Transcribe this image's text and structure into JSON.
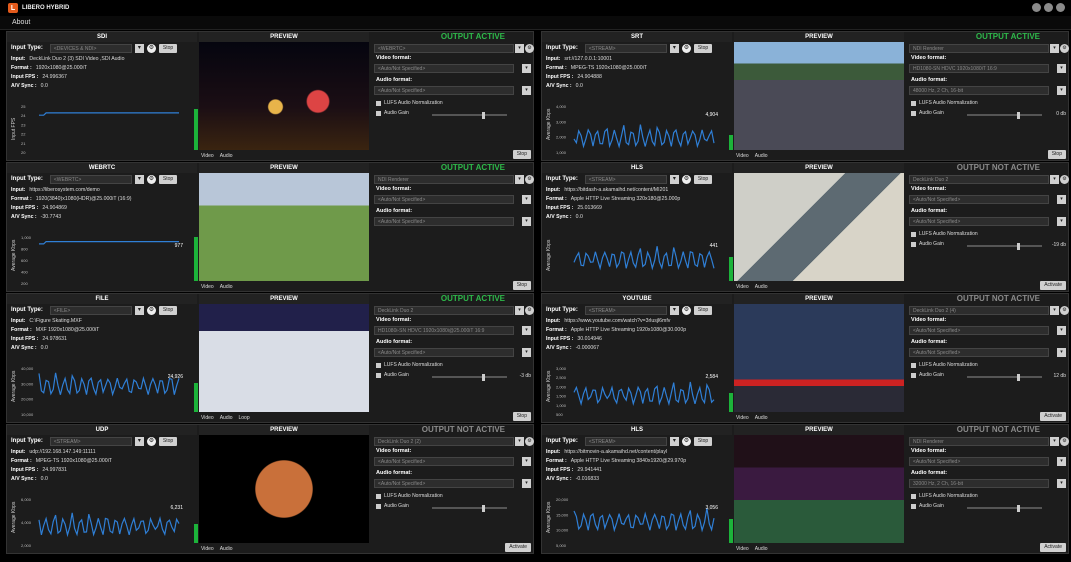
{
  "app": {
    "title": "LIBERO HYBRID",
    "menu": [
      "About"
    ]
  },
  "panels": [
    {
      "id": "sdi",
      "source_title": "SDI",
      "input_type_placeholder": "<DEVICES & NDI>",
      "action": "Stop",
      "input_label": "Input:",
      "input": "DeckLink Duo 2 (3) SDI Video ,SDI Audio",
      "format_label": "Format :",
      "format": "1920x1080@25.000iT",
      "fps_label": "Input FPS :",
      "fps": "24.996367",
      "sync_label": "A/V Sync :",
      "sync": "0.0",
      "chart": {
        "ylabel": "Input FPS",
        "yticks": [
          "25",
          "24",
          "23",
          "22",
          "21",
          "20"
        ],
        "level": 0.85,
        "value_label": ""
      },
      "preview_footer": [
        "Video",
        "Audio"
      ],
      "output": {
        "status": "OUTPUT ACTIVE",
        "active": true,
        "renderer_placeholder": "<WEBRTC>",
        "video_format_label": "Video format:",
        "video_format": "<Auto/Not Specified>",
        "audio_format_label": "Audio format:",
        "audio_format": "<Auto/Not Specified>",
        "lufs": "LUFS Audio Normalization",
        "gain_label": "Audio Gain",
        "gain_value": "",
        "button": "Stop"
      }
    },
    {
      "id": "webrtc",
      "source_title": "WEBRTC",
      "input_type_placeholder": "<WEBRTC>",
      "action": "Stop",
      "input_label": "Input:",
      "input": "https://liberosystem.com/demo",
      "format_label": "Format :",
      "format": "1920(3840)x1080(HDR)@25.000iT (16:9)",
      "fps_label": "Input FPS :",
      "fps": "24.904869",
      "sync_label": "A/V Sync :",
      "sync": "-30.7743",
      "chart": {
        "ylabel": "Average Kbps",
        "yticks": [
          "1,000",
          "800",
          "600",
          "400",
          "200"
        ],
        "level": 0.9,
        "value_label": "977"
      },
      "preview_footer": [
        "Video",
        "Audio"
      ],
      "output": {
        "status": "OUTPUT ACTIVE",
        "active": true,
        "renderer_placeholder": "NDI Renderer",
        "video_format_label": "Video format:",
        "video_format": "<Auto/Not Specified>",
        "audio_format_label": "Audio format:",
        "audio_format": "<Auto/Not Specified>",
        "lufs": "",
        "gain_label": "",
        "gain_value": "",
        "button": "Stop"
      }
    },
    {
      "id": "file",
      "source_title": "FILE",
      "input_type_placeholder": "<FILE>",
      "action": "Stop",
      "input_label": "Input:",
      "input": "C:\\Figure Skating.MXF",
      "format_label": "Format :",
      "format": "MXF  1920x1080@25.000iT",
      "fps_label": "Input FPS :",
      "fps": "24.978631",
      "sync_label": "A/V Sync :",
      "sync": "0.0",
      "chart": {
        "ylabel": "Average Kbps",
        "yticks": [
          "40,000",
          "30,000",
          "20,000",
          "10,000"
        ],
        "level": 0.6,
        "value_label": "24,926"
      },
      "preview_footer": [
        "Video",
        "Audio",
        "Loop"
      ],
      "output": {
        "status": "OUTPUT ACTIVE",
        "active": true,
        "renderer_placeholder": "DeckLink Duo 2",
        "video_format_label": "Video format:",
        "video_format": "HD1080i-SN HDVC  1920x1080i@25.000iT 16:9",
        "audio_format_label": "Audio format:",
        "audio_format": "<Auto/Not Specified>",
        "lufs": "LUFS Audio Normalization",
        "gain_label": "Audio Gain",
        "gain_value": "-3 db",
        "button": "Stop"
      }
    },
    {
      "id": "udp",
      "source_title": "UDP",
      "input_type_placeholder": "<STREAM>",
      "action": "Stop",
      "input_label": "Input:",
      "input": "udp://192.168.147.149:11111",
      "format_label": "Format :",
      "format": "MPEG-TS  1920x1080@25.000iT",
      "fps_label": "Input FPS :",
      "fps": "24.997831",
      "sync_label": "A/V Sync :",
      "sync": "0.0",
      "chart": {
        "ylabel": "Average Kbps",
        "yticks": [
          "6,000",
          "4,000",
          "2,000"
        ],
        "level": 0.4,
        "value_label": "6,231"
      },
      "preview_footer": [
        "Video",
        "Audio"
      ],
      "output": {
        "status": "OUTPUT NOT ACTIVE",
        "active": false,
        "renderer_placeholder": "DeckLink Duo 2 (2)",
        "video_format_label": "Video format:",
        "video_format": "<Auto/Not Specified>",
        "audio_format_label": "Audio format:",
        "audio_format": "<Auto/Not Specified>",
        "lufs": "LUFS Audio Normalization",
        "gain_label": "Audio Gain",
        "gain_value": "",
        "button": "Activate"
      }
    },
    {
      "id": "srt",
      "source_title": "SRT",
      "input_type_placeholder": "<STREAM>",
      "action": "Stop",
      "input_label": "Input:",
      "input": "srt://127.0.0.1:10001",
      "format_label": "Format :",
      "format": "MPEG-TS  1920x1080@25.000iT",
      "fps_label": "Input FPS :",
      "fps": "24.904888",
      "sync_label": "A/V Sync :",
      "sync": "0.0",
      "chart": {
        "ylabel": "Average Kbps",
        "yticks": [
          "4,000",
          "3,000",
          "2,000",
          "1,000"
        ],
        "level": 0.3,
        "value_label": "4,904"
      },
      "preview_footer": [
        "Video",
        "Audio"
      ],
      "output": {
        "status": "OUTPUT ACTIVE",
        "active": true,
        "renderer_placeholder": "NDI Renderer",
        "video_format_label": "Video format:",
        "video_format": "HD1080-SN HDVC 1920x1080iT 16:9",
        "audio_format_label": "Audio format:",
        "audio_format": "48000 Hz, 2 Ch, 16-bit",
        "lufs": "LUFS Audio Normalization",
        "gain_label": "Audio Gain",
        "gain_value": "0 db",
        "button": "Stop"
      }
    },
    {
      "id": "hls1",
      "source_title": "HLS",
      "input_type_placeholder": "<STREAM>",
      "action": "Stop",
      "input_label": "Input:",
      "input": "https://bitdash-a.akamaihd.net/content/MI201",
      "format_label": "Format :",
      "format": "Apple HTTP Live Streaming 320x180@25.000p",
      "fps_label": "Input FPS :",
      "fps": "25.013669",
      "sync_label": "A/V Sync :",
      "sync": "0.0",
      "chart": {
        "ylabel": "Average Kbps",
        "yticks": [],
        "level": 0.5,
        "value_label": "441"
      },
      "preview_footer": [
        "Video",
        "Audio"
      ],
      "output": {
        "status": "OUTPUT NOT ACTIVE",
        "active": false,
        "renderer_placeholder": "DeckLink Duo 2",
        "video_format_label": "Video format:",
        "video_format": "<Auto/Not Specified>",
        "audio_format_label": "Audio format:",
        "audio_format": "<Auto/Not Specified>",
        "lufs": "LUFS Audio Normalization",
        "gain_label": "Audio Gain",
        "gain_value": "-19 db",
        "button": "Activate"
      }
    },
    {
      "id": "youtube",
      "source_title": "YOUTUBE",
      "input_type_placeholder": "<STREAM>",
      "action": "Stop",
      "input_label": "Input:",
      "input": "https://www.youtube.com/watch?v=3rlusjl6mfv",
      "format_label": "Format :",
      "format": "Apple HTTP Live Streaming 1920x1080@30.000p",
      "fps_label": "Input FPS :",
      "fps": "30.014946",
      "sync_label": "A/V Sync :",
      "sync": "-0.000067",
      "chart": {
        "ylabel": "Average Kbps",
        "yticks": [
          "3,000",
          "2,500",
          "2,000",
          "1,500",
          "1,000",
          "500"
        ],
        "level": 0.4,
        "value_label": "2,584"
      },
      "preview_footer": [
        "Video",
        "Audio"
      ],
      "output": {
        "status": "OUTPUT NOT ACTIVE",
        "active": false,
        "renderer_placeholder": "DeckLink Duo 2 (4)",
        "video_format_label": "Video format:",
        "video_format": "<Auto/Not Specified>",
        "audio_format_label": "Audio format:",
        "audio_format": "<Auto/Not Specified>",
        "lufs": "LUFS Audio Normalization",
        "gain_label": "Audio Gain",
        "gain_value": "12 db",
        "button": "Activate"
      }
    },
    {
      "id": "hls2",
      "source_title": "HLS",
      "input_type_placeholder": "<STREAM>",
      "action": "Stop",
      "input_label": "Input:",
      "input": "https://bitmovin-a.akamaihd.net/content/playl",
      "format_label": "Format :",
      "format": "Apple HTTP Live Streaming 3840x1920@29.970p",
      "fps_label": "Input FPS :",
      "fps": "29.941441",
      "sync_label": "A/V Sync :",
      "sync": "-0.016833",
      "chart": {
        "ylabel": "Average Kbps",
        "yticks": [
          "20,000",
          "15,000",
          "10,000",
          "5,000"
        ],
        "level": 0.5,
        "value_label": "3,056"
      },
      "preview_footer": [
        "Video",
        "Audio"
      ],
      "output": {
        "status": "OUTPUT NOT ACTIVE",
        "active": false,
        "renderer_placeholder": "NDI Renderer",
        "video_format_label": "Video format:",
        "video_format": "<Auto/Not Specified>",
        "audio_format_label": "Audio format:",
        "audio_format": "32000 Hz, 2 Ch, 16-bit",
        "lufs": "LUFS Audio Normalization",
        "gain_label": "Audio Gain",
        "gain_value": "",
        "button": "Activate"
      }
    }
  ],
  "preview_label": "PREVIEW",
  "input_type_label": "Input Type:",
  "colors": {
    "active": "#2eb84a",
    "inactive": "#8a8a8a",
    "chart_line": "#2f7fd6",
    "level": "#1cb33a"
  },
  "icons": {
    "settings": "gear-icon",
    "dropdown": "chevron-down-icon"
  }
}
